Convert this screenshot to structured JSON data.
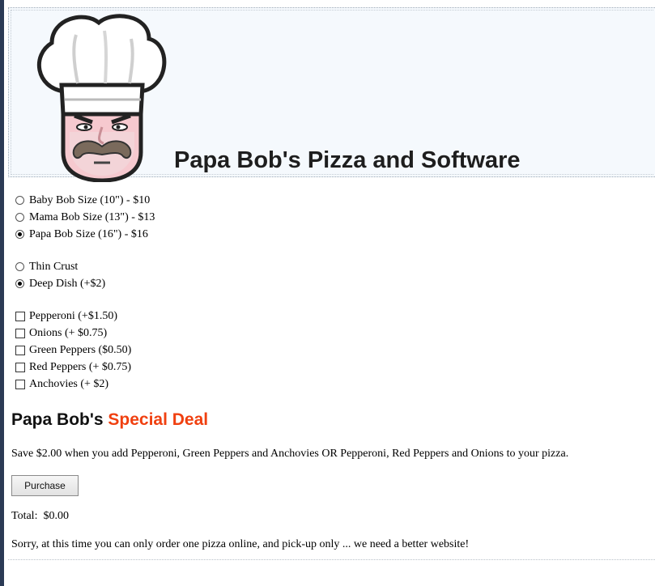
{
  "header": {
    "title": "Papa Bob's Pizza and Software",
    "logo_icon": "chef-mustache-logo-icon"
  },
  "sizes": [
    {
      "label": "Baby Bob Size (10\") - $10",
      "checked": false
    },
    {
      "label": "Mama Bob Size (13\") - $13",
      "checked": false
    },
    {
      "label": "Papa Bob Size (16\") - $16",
      "checked": true
    }
  ],
  "crusts": [
    {
      "label": "Thin Crust",
      "checked": false
    },
    {
      "label": "Deep Dish (+$2)",
      "checked": true
    }
  ],
  "toppings": [
    {
      "label": "Pepperoni (+$1.50)",
      "checked": false
    },
    {
      "label": "Onions (+ $0.75)",
      "checked": false
    },
    {
      "label": "Green Peppers ($0.50)",
      "checked": false
    },
    {
      "label": "Red Peppers (+ $0.75)",
      "checked": false
    },
    {
      "label": "Anchovies (+ $2)",
      "checked": false
    }
  ],
  "deal": {
    "heading_prefix": "Papa Bob's",
    "heading_accent": "Special Deal",
    "text": "Save $2.00 when you add Pepperoni, Green Peppers and Anchovies OR Pepperoni, Red Peppers and Onions to your pizza."
  },
  "purchase_label": "Purchase",
  "total_text": "Total:  $0.00",
  "footer_note": "Sorry, at this time you can only order one pizza online, and pick-up only ... we need a better website!",
  "colors": {
    "accent": "#f04010",
    "header_bg": "#f5f9fd"
  }
}
